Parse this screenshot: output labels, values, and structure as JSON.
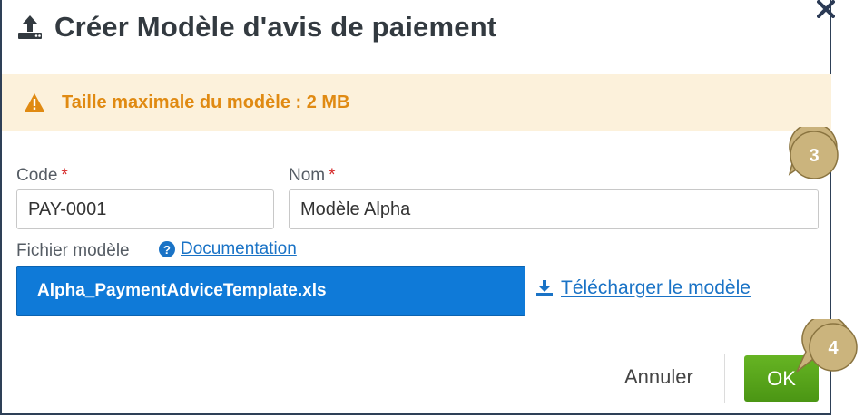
{
  "dialog": {
    "title": "Créer Modèle d'avis de paiement",
    "title_icon": "upload-icon",
    "close_icon": "close-icon"
  },
  "warning": {
    "icon": "warning-icon",
    "text": "Taille maximale du modèle : 2 MB",
    "color": "#e08a12",
    "background": "#fcf1db"
  },
  "form": {
    "code_label": "Code",
    "code_value": "PAY-0001",
    "name_label": "Nom",
    "name_value": "Modèle Alpha",
    "required_mark": "*",
    "file_label": "Fichier modèle",
    "doc_link": "Documentation",
    "file_name": "Alpha_PaymentAdviceTemplate.xls",
    "download_link": "Télécharger le modèle"
  },
  "actions": {
    "cancel_label": "Annuler",
    "ok_label": "OK",
    "ok_color": "#5aa51c"
  },
  "callouts": [
    "3",
    "4"
  ]
}
